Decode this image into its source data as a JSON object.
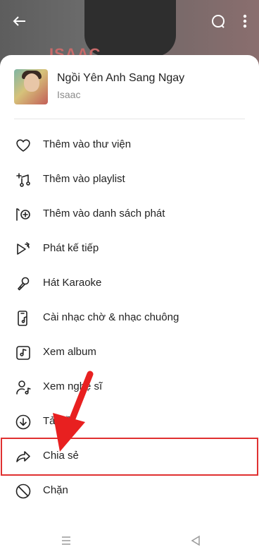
{
  "background": {
    "banner_text": "ISAAC"
  },
  "song": {
    "title": "Ngồi Yên Anh Sang Ngay",
    "artist": "Isaac"
  },
  "menu": [
    {
      "label": "Thêm vào thư viện",
      "icon": "heart-icon"
    },
    {
      "label": "Thêm vào playlist",
      "icon": "add-to-playlist-icon"
    },
    {
      "label": "Thêm vào danh sách phát",
      "icon": "add-to-queue-icon"
    },
    {
      "label": "Phát kế tiếp",
      "icon": "play-next-icon"
    },
    {
      "label": "Hát Karaoke",
      "icon": "microphone-icon"
    },
    {
      "label": "Cài nhạc chờ & nhạc chuông",
      "icon": "ringtone-icon"
    },
    {
      "label": "Xem album",
      "icon": "album-icon"
    },
    {
      "label": "Xem nghệ sĩ",
      "icon": "artist-icon"
    },
    {
      "label": "Tải về",
      "icon": "download-icon"
    },
    {
      "label": "Chia sẻ",
      "icon": "share-icon"
    },
    {
      "label": "Chặn",
      "icon": "block-icon"
    }
  ],
  "colors": {
    "highlight": "#e03030",
    "sheet": "#ffffff"
  }
}
